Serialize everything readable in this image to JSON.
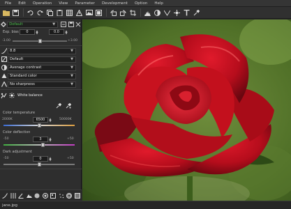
{
  "menu": [
    {
      "label": "File",
      "key": "F"
    },
    {
      "label": "Edit",
      "key": "E"
    },
    {
      "label": "Operation",
      "key": "O"
    },
    {
      "label": "View",
      "key": "V"
    },
    {
      "label": "Parameter",
      "key": "P"
    },
    {
      "label": "Development",
      "key": "D"
    },
    {
      "label": "Option",
      "key": "O"
    },
    {
      "label": "Help",
      "key": "H"
    }
  ],
  "toolbar_icons": [
    "open-icon",
    "save-icon",
    "undo-icon",
    "redo-icon",
    "copy-icon",
    "paste-icon",
    "grid-icon",
    "warning-icon",
    "picture-icon",
    "fullscreen-icon",
    "rotate-left-icon",
    "rotate-right-icon",
    "crop-icon",
    "histogram-icon",
    "exposure-icon",
    "wb-icon",
    "hdr-icon",
    "text-icon",
    "eyedropper-icon"
  ],
  "panel": {
    "profile_label": "Default",
    "exp_bias": {
      "label": "Exp. bias",
      "value": "0",
      "value2": "0.0",
      "min": "-3.00",
      "max": "+3.00",
      "level": 0.5
    },
    "gamma_value": "8.8",
    "tone_preset": "Default",
    "contrast": "Average contrast",
    "color": "Standard color",
    "sharpness": "No sharpness",
    "white_balance": "White balance",
    "color_temperature": {
      "label": "Color temperature",
      "min": "2000K",
      "value": "6500",
      "max": "50000K",
      "level": 0.5
    },
    "color_deflection": {
      "label": "Color deflection",
      "min": "-50",
      "value": "3",
      "max": "+50",
      "level": 0.55
    },
    "dark_adjustment": {
      "label": "Dark adjustment",
      "min": "-50",
      "value": "0",
      "max": "+50",
      "level": 0.5
    }
  },
  "status": {
    "filename": "jane.jpg"
  },
  "colors": {
    "accent_green": "#4cc24c",
    "temperature_left": "#3a6dd8",
    "temperature_right": "#e0a040",
    "deflection_left": "#3fae3f",
    "deflection_right": "#c33bc3"
  }
}
